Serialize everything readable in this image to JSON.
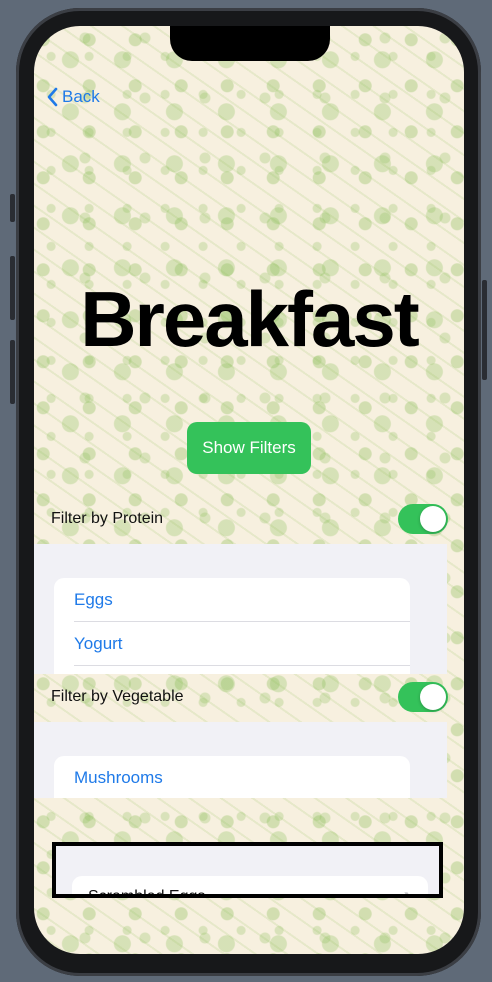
{
  "nav": {
    "back_label": "Back"
  },
  "title": "Breakfast",
  "show_filters_label": "Show Filters",
  "protein_filter": {
    "label": "Filter by Protein",
    "enabled": true,
    "items": [
      "Eggs",
      "Yogurt"
    ]
  },
  "vegetable_filter": {
    "label": "Filter by Vegetable",
    "enabled": true,
    "items": [
      "Mushrooms"
    ]
  },
  "results": {
    "items": [
      "Scrambled Eggs"
    ]
  },
  "colors": {
    "accent_blue": "#1f7ae8",
    "toggle_green": "#34c25a",
    "background": "#f7f0df"
  },
  "icons": [
    "chevron-left-icon",
    "chevron-right-icon"
  ]
}
